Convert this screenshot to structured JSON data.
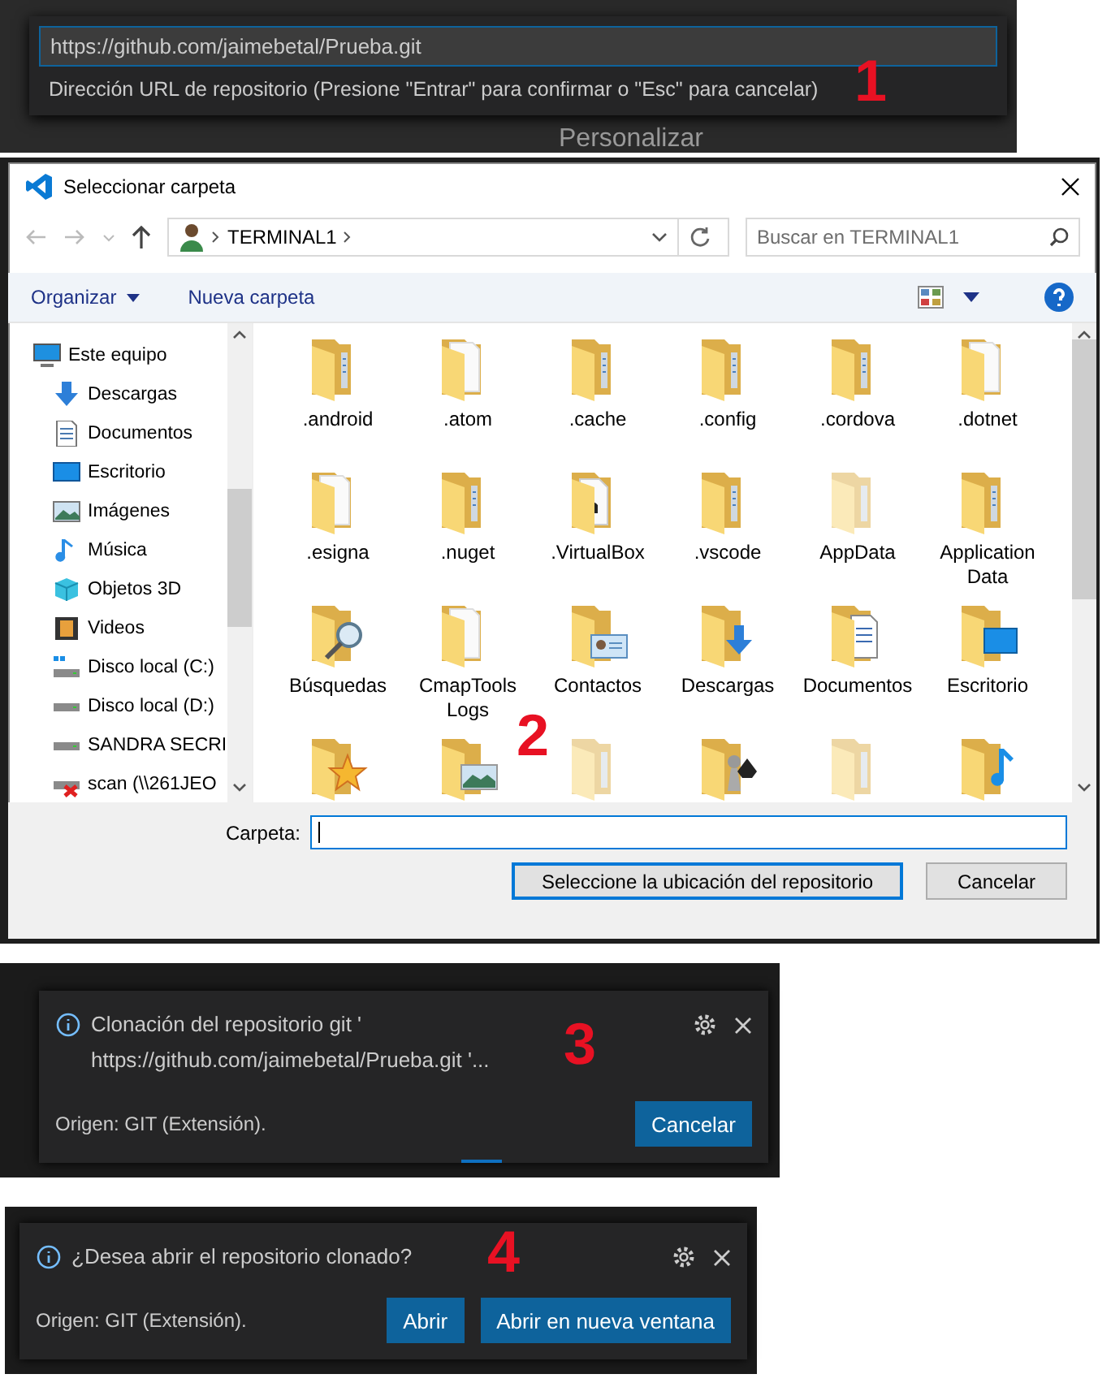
{
  "quick_input": {
    "value": "https://github.com/jaimebetal/Prueba.git",
    "hint": "Dirección URL de repositorio (Presione \"Entrar\" para confirmar o \"Esc\" para cancelar)",
    "background_text": "Personalizar",
    "annotation": "1"
  },
  "dialog": {
    "title": "Seleccionar carpeta",
    "breadcrumb": [
      "TERMINAL1"
    ],
    "search_placeholder": "Buscar en TERMINAL1",
    "toolbar": [
      "Organizar",
      "Nueva carpeta"
    ],
    "nav_items": [
      {
        "label": "Este equipo",
        "kind": "computer",
        "children": [
          {
            "label": "Descargas",
            "kind": "downloads"
          },
          {
            "label": "Documentos",
            "kind": "documents"
          },
          {
            "label": "Escritorio",
            "kind": "desktop"
          },
          {
            "label": "Imágenes",
            "kind": "pictures"
          },
          {
            "label": "Música",
            "kind": "music"
          },
          {
            "label": "Objetos 3D",
            "kind": "objects3d"
          },
          {
            "label": "Videos",
            "kind": "videos"
          },
          {
            "label": "Disco local (C:)",
            "kind": "system_drive"
          },
          {
            "label": "Disco local (D:)",
            "kind": "drive"
          },
          {
            "label": "SANDRA SECRI",
            "kind": "drive"
          },
          {
            "label": "scan (\\\\261JEO",
            "kind": "network_drive"
          }
        ]
      }
    ],
    "folders": [
      {
        "label": ".android",
        "kind": "plain"
      },
      {
        "label": ".atom",
        "kind": "files"
      },
      {
        "label": ".cache",
        "kind": "plain"
      },
      {
        "label": ".config",
        "kind": "plain"
      },
      {
        "label": ".cordova",
        "kind": "plain"
      },
      {
        "label": ".dotnet",
        "kind": "files"
      },
      {
        "label": ".esigna",
        "kind": "files"
      },
      {
        "label": ".nuget",
        "kind": "plain"
      },
      {
        "label": ".VirtualBox",
        "kind": "virtualbox"
      },
      {
        "label": ".vscode",
        "kind": "plain"
      },
      {
        "label": "AppData",
        "kind": "hidden"
      },
      {
        "label": "Application Data",
        "kind": "plain"
      },
      {
        "label": "Búsquedas",
        "kind": "search"
      },
      {
        "label": "CmapTools Logs",
        "kind": "files"
      },
      {
        "label": "Contactos",
        "kind": "contacts"
      },
      {
        "label": "Descargas",
        "kind": "downloads"
      },
      {
        "label": "Documentos",
        "kind": "documents"
      },
      {
        "label": "Escritorio",
        "kind": "desktop"
      },
      {
        "kind": "star"
      },
      {
        "kind": "pictures"
      },
      {
        "kind": "hidden"
      },
      {
        "kind": "games"
      },
      {
        "kind": "hidden"
      },
      {
        "kind": "music"
      }
    ],
    "folder_label": "Carpeta:",
    "buttons": [
      {
        "label": "Seleccione la ubicación del repositorio",
        "default": true
      },
      {
        "label": "Cancelar",
        "default": false
      }
    ],
    "annotation": "2"
  },
  "toasts": [
    {
      "message": "Clonación del repositorio git ' https://github.com/jaimebetal/Prueba.git '...",
      "source": "Origen: GIT (Extensión).",
      "buttons": [
        "Cancelar"
      ],
      "busy": true,
      "annotation": "3"
    },
    {
      "message": "¿Desea abrir el repositorio clonado?",
      "source": "Origen: GIT (Extensión).",
      "buttons": [
        "Abrir",
        "Abrir en nueva ventana"
      ],
      "busy": false,
      "annotation": "4"
    }
  ]
}
